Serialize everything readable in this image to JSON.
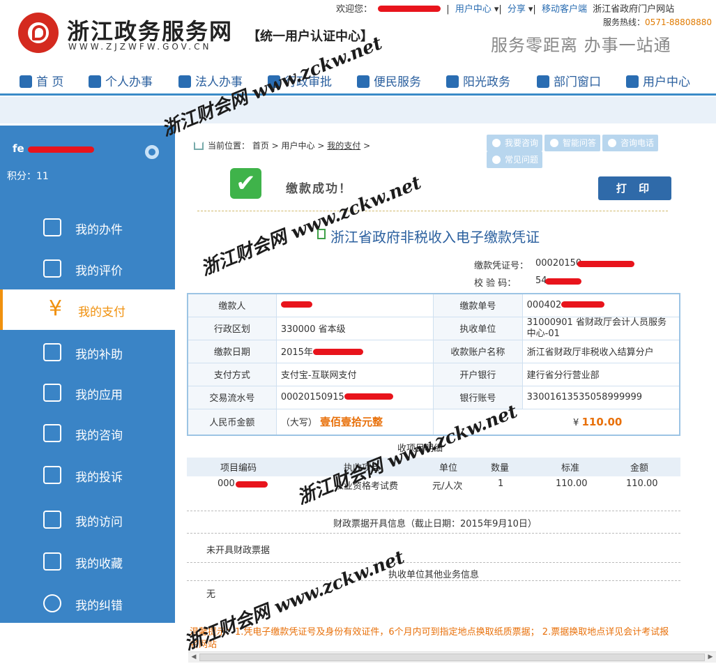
{
  "header": {
    "welcome": "欢迎您：",
    "user_center": "用户中心",
    "share": "分享",
    "mobile": "移动客户端",
    "portal": "浙江省政府门户网站",
    "hotline_label": "服务热线：",
    "hotline": "0571-88808880",
    "site_title": "浙江政务服务网",
    "site_url": "WWW.ZJZWFW.GOV.CN",
    "site_sub": "【统一用户认证中心】",
    "slogan": "服务零距离  办事一站通"
  },
  "nav": [
    "首 页",
    "个人办事",
    "法人办事",
    "行政审批",
    "便民服务",
    "阳光政务",
    "部门窗口",
    "用户中心"
  ],
  "sidebar": {
    "user": "fe",
    "points": "积分：11",
    "items": [
      "我的办件",
      "我的评价",
      "我的支付",
      "我的补助",
      "我的应用",
      "我的咨询",
      "我的投诉",
      "我的访问",
      "我的收藏",
      "我的纠错"
    ],
    "active_index": 2,
    "active_icon": "¥"
  },
  "breadcrumb": {
    "label": "当前位置：",
    "home": "首页",
    "center": "用户中心",
    "current": "我的支付"
  },
  "tools": [
    "我要咨询",
    "智能问答",
    "咨询电话",
    "常见问题"
  ],
  "success": {
    "text": "缴款成功！",
    "print": "打 印"
  },
  "doc": {
    "title": "浙江省政府非税收入电子缴款凭证",
    "voucher_label": "缴款凭证号：",
    "voucher_value": "00020150",
    "check_label": "校 验 码：",
    "check_value": "54"
  },
  "info": {
    "payer_k": "缴款人",
    "payer_v": "",
    "order_k": "缴款单号",
    "order_v": "000402",
    "region_k": "行政区划",
    "region_v": "330000  省本级",
    "unit_k": "执收单位",
    "unit_v": "31000901  省财政厅会计人员服务中心-01",
    "date_k": "缴款日期",
    "date_v": "2015年",
    "acct_name_k": "收款账户名称",
    "acct_name_v": "浙江省财政厅非税收入结算分户",
    "pay_k": "支付方式",
    "pay_v": "支付宝-互联网支付",
    "bank_k": "开户银行",
    "bank_v": "建行省分行营业部",
    "serial_k": "交易流水号",
    "serial_v": "00020150915",
    "acct_k": "银行账号",
    "acct_v": "33001613535058999999",
    "amount_k": "人民币金额",
    "amount_cap_label": "（大写）",
    "amount_cap": "壹佰壹拾元整",
    "amount_sym": "¥",
    "amount": "110.00"
  },
  "detail": {
    "title": "收项目明细",
    "headers": [
      "项目编码",
      "执收项目",
      "单位",
      "数量",
      "标准",
      "金额"
    ],
    "row": {
      "code": "000",
      "item": "从业资格考试费",
      "unit": "元/人次",
      "qty": "1",
      "std": "110.00",
      "amt": "110.00"
    }
  },
  "bill": {
    "title": "财政票据开具信息（截止日期：2015年9月10日）",
    "value": "未开具财政票据"
  },
  "other": {
    "title": "执收单位其他业务信息",
    "value": "无"
  },
  "tip": "温馨提示：1.凭电子缴款凭证号及身份有效证件，6个月内可到指定地点换取纸质票据；  2.票据换取地点详见会计考试报名网站",
  "watermark": {
    "cn": "浙江财会网",
    "en": "www.zckw.net"
  }
}
